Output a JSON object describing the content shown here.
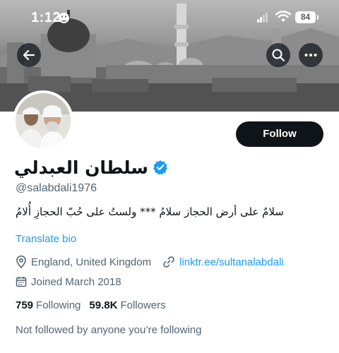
{
  "status_bar": {
    "time": "1:12",
    "battery": "84"
  },
  "header": {
    "back_icon": "back-arrow-icon",
    "search_icon": "search-icon",
    "more_icon": "more-icon"
  },
  "profile": {
    "display_name": "سلطان العبدلي",
    "handle": "@salabdali1976",
    "bio": "سلامٌ على أرض الحجاز سلامُ *** ولستُ على حُبّ الحجازِ أُلامُ",
    "translate_label": "Translate bio",
    "location": "England, United Kingdom",
    "link": "linktr.ee/sultanalabdali",
    "joined": "Joined March 2018",
    "following_count": "759",
    "following_label": "Following",
    "followers_count": "59.8K",
    "followers_label": "Followers",
    "not_followed": "Not followed by anyone you’re following",
    "follow_label": "Follow"
  },
  "colors": {
    "accent": "#1d9bf0",
    "text": "#0f1419",
    "secondary": "#536471"
  }
}
